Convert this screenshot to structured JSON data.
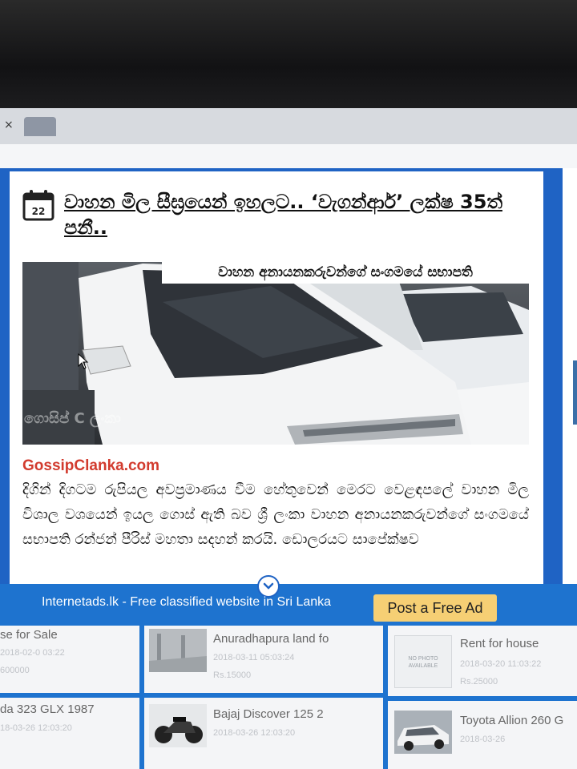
{
  "browser": {
    "tab_close": "×"
  },
  "article": {
    "date_day": "22",
    "title": "වාහන මිල සීඝ්‍රයෙන් ඉහලට.. ‘වැගන්ආර්’ ලක්ෂ 35ත් පනී..",
    "image_caption": "වාහන අනායනකරුවන්ගේ සංගමයේ සභාපති",
    "watermark": "ගොසිප් C ලංකා",
    "site": "GossipClanka.com",
    "body": "දිගින් දිගටම රුපියල අවප්‍රමාණය වීම හේතුවෙන් මෙරට වෙළඳපලේ වාහන මිල විශාල වශයෙන් ඉයල ගොස් ඇති බව ශ්‍රී ලංකා වාහන අනායනකරුවන්ගේ සංගමයේ සභාපති රන්ජන් පීරිස් මහතා සදහන් කරයි. ඩොලරයට සාපේක්ෂව"
  },
  "adbar": {
    "text": "Internetads.lk - Free classified website in Sri Lanka",
    "button": "Post a Free Ad"
  },
  "ads": [
    {
      "title": "se for Sale",
      "date": "2018-02-0 03:22",
      "price": "600000"
    },
    {
      "title": "Anuradhapura land fo",
      "date": "2018-03-11 05:03:24",
      "price": "Rs.15000"
    },
    {
      "title": "Rent for house",
      "date": "2018-03-20 11:03:22",
      "price": "Rs.25000",
      "thumb_text": "NO PHOTO AVAILABLE"
    },
    {
      "title": "da 323 GLX 1987",
      "date": "18-03-26 12:03:20",
      "price": ""
    },
    {
      "title": "Bajaj Discover 125 2",
      "date": "2018-03-26 12:03:20",
      "price": ""
    },
    {
      "title": "Toyota Allion 260 G",
      "date": "2018-03-26",
      "price": ""
    }
  ]
}
